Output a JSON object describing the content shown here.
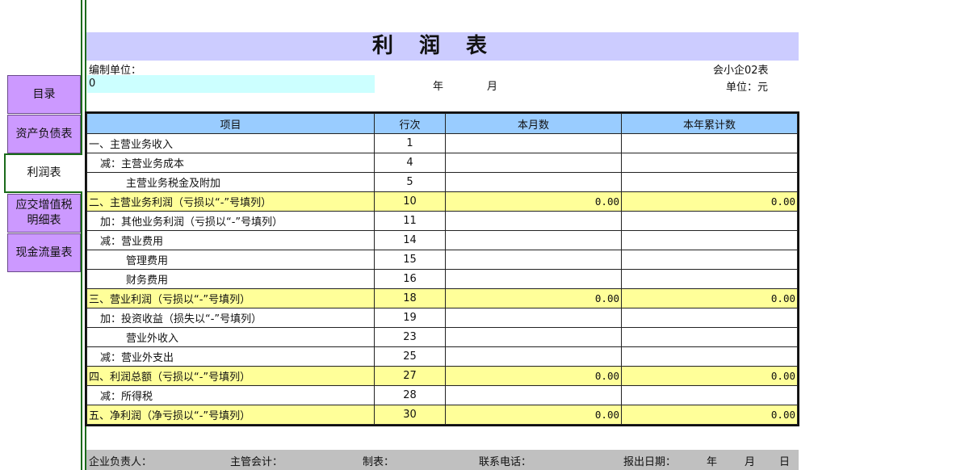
{
  "nav": {
    "items": [
      {
        "label": "目录"
      },
      {
        "label": "资产负债表"
      },
      {
        "label": "利润表",
        "active": true
      },
      {
        "label": "应交增值税明细表"
      },
      {
        "label": "现金流量表"
      }
    ]
  },
  "header": {
    "title": "利润表",
    "company_label": "编制单位：",
    "company_value": "0",
    "year_label": "年",
    "month_label": "月",
    "form_code": "会小企02表",
    "unit": "单位：元"
  },
  "table": {
    "columns": [
      "项目",
      "行次",
      "本月数",
      "本年累计数"
    ],
    "rows": [
      {
        "item": "一、主营业务收入",
        "line": "1",
        "month": "",
        "ytd": ""
      },
      {
        "item": "减：主营业务成本",
        "line": "4",
        "month": "",
        "ytd": ""
      },
      {
        "item": "主营业务税金及附加",
        "line": "5",
        "month": "",
        "ytd": ""
      },
      {
        "item": "二、主营业务利润（亏损以“-”号填列）",
        "line": "10",
        "month": "0.00",
        "ytd": "0.00"
      },
      {
        "item": "加：其他业务利润（亏损以“-”号填列）",
        "line": "11",
        "month": "",
        "ytd": ""
      },
      {
        "item": "减：营业费用",
        "line": "14",
        "month": "",
        "ytd": ""
      },
      {
        "item": "管理费用",
        "line": "15",
        "month": "",
        "ytd": ""
      },
      {
        "item": "财务费用",
        "line": "16",
        "month": "",
        "ytd": ""
      },
      {
        "item": "三、营业利润（亏损以“-”号填列）",
        "line": "18",
        "month": "0.00",
        "ytd": "0.00"
      },
      {
        "item": "加：投资收益（损失以“-”号填列）",
        "line": "19",
        "month": "",
        "ytd": ""
      },
      {
        "item": "营业外收入",
        "line": "23",
        "month": "",
        "ytd": ""
      },
      {
        "item": "减：营业外支出",
        "line": "25",
        "month": "",
        "ytd": ""
      },
      {
        "item": "四、利润总额（亏损以“-”号填列）",
        "line": "27",
        "month": "0.00",
        "ytd": "0.00"
      },
      {
        "item": "减：所得税",
        "line": "28",
        "month": "",
        "ytd": ""
      },
      {
        "item": "五、净利润（净亏损以“-”号填列）",
        "line": "30",
        "month": "0.00",
        "ytd": "0.00"
      }
    ]
  },
  "footer": {
    "manager": "企业负责人：",
    "accountant": "主管会计：",
    "preparer": "制表：",
    "phone": "联系电话：",
    "date": "报出日期：",
    "year": "年",
    "month": "月",
    "day": "日"
  },
  "colors": {
    "nav_button": "#cc99ff",
    "title_bar": "#ccccff",
    "header_row": "#99ccff",
    "highlight_row": "#ffff99",
    "input_cell": "#ccffff",
    "footer_bar": "#c0c0c0"
  }
}
